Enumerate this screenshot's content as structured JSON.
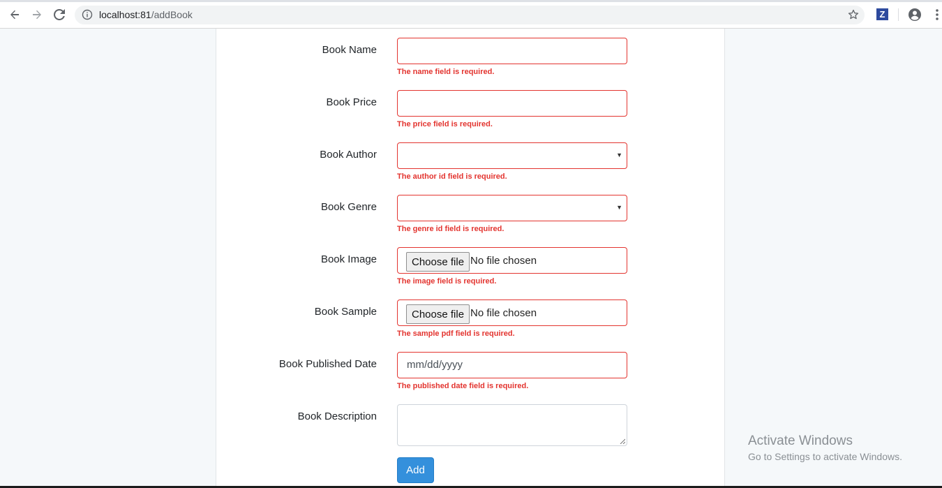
{
  "browser": {
    "url_host": "localhost:81",
    "url_path": "/addBook",
    "extension_label": "Z"
  },
  "form": {
    "fields": [
      {
        "label": "Book Name",
        "type": "text",
        "error": "The name field is required."
      },
      {
        "label": "Book Price",
        "type": "text",
        "error": "The price field is required."
      },
      {
        "label": "Book Author",
        "type": "select",
        "error": "The author id field is required."
      },
      {
        "label": "Book Genre",
        "type": "select",
        "error": "The genre id field is required."
      },
      {
        "label": "Book Image",
        "type": "file",
        "button": "Choose file",
        "status": "No file chosen",
        "error": "The image field is required."
      },
      {
        "label": "Book Sample",
        "type": "file",
        "button": "Choose file",
        "status": "No file chosen",
        "error": "The sample pdf field is required."
      },
      {
        "label": "Book Published Date",
        "type": "date",
        "placeholder": "mm/dd/yyyy",
        "error": "The published date field is required."
      },
      {
        "label": "Book Description",
        "type": "textarea"
      }
    ],
    "submit_label": "Add"
  },
  "watermark": {
    "title": "Activate Windows",
    "subtitle": "Go to Settings to activate Windows."
  },
  "colors": {
    "error": "#e3342f",
    "primary": "#3490dc"
  }
}
